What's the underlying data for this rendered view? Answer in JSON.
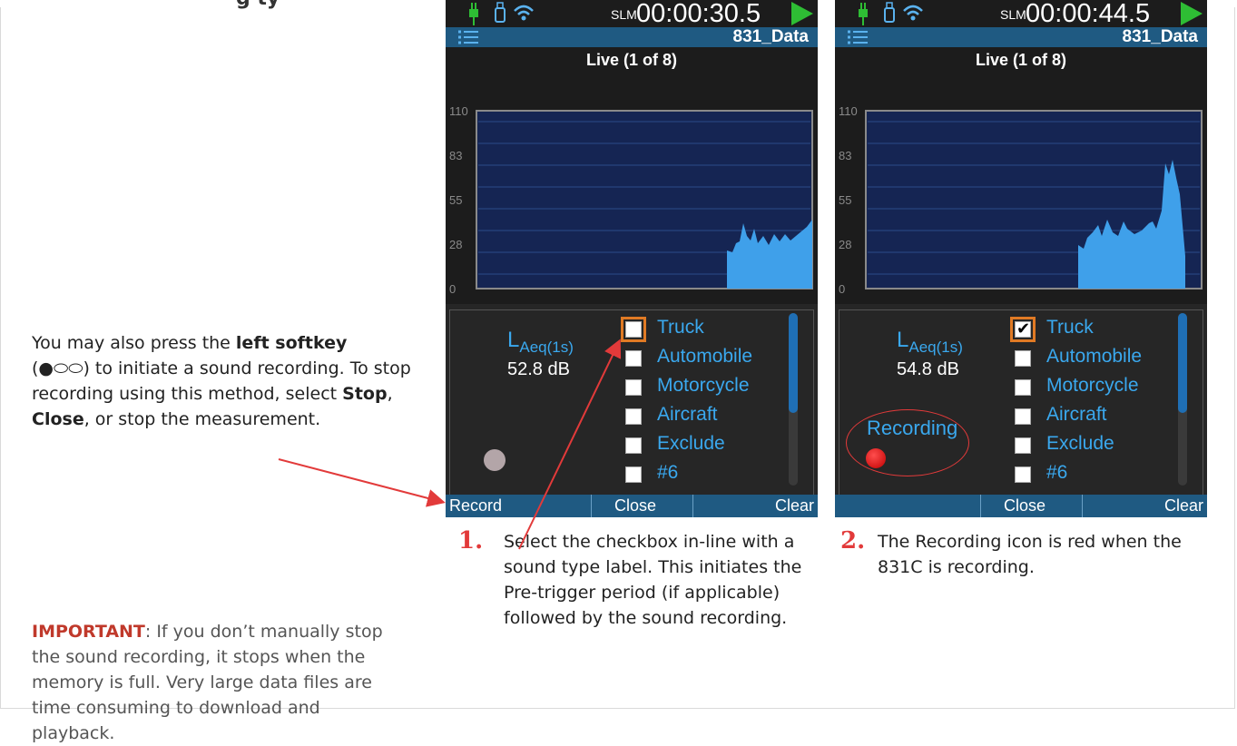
{
  "page": {
    "header_fragment": "g             ty",
    "left_note": {
      "text_1": "You may also press the ",
      "softkey_bold": "left softkey",
      "softkey_symbol": "(●⬭⬭)",
      "text_2": " to initiate a sound recording. To stop recording using this method, select ",
      "stop": "Stop",
      "comma": ", ",
      "close": "Close",
      "text_3": ", or stop the measurement."
    },
    "important": {
      "label": "IMPORTANT",
      "text": ": If you don’t manually stop the sound recording, it stops when the memory is full. Very large data files are time consuming to download and playback."
    },
    "steps": [
      {
        "num": "1.",
        "text": "Select the checkbox in-line with a sound type label. This initiates the Pre-trigger period (if applicable) followed by the sound recording."
      },
      {
        "num": "2.",
        "text": "The Recording icon is red when the 831C is recording."
      }
    ]
  },
  "devices": [
    {
      "slm": "SLM",
      "timer": "00:00:30.5",
      "datafile": "831_Data",
      "live": "Live (1 of 8)",
      "y_ticks": [
        "110",
        "83",
        "55",
        "28",
        "0"
      ],
      "laeq_main": "L",
      "laeq_sub": "Aeq(1s)",
      "db": "52.8 dB",
      "checkboxes": [
        {
          "label": "Truck",
          "checked": false,
          "focused": true
        },
        {
          "label": "Automobile",
          "checked": false
        },
        {
          "label": "Motorcycle",
          "checked": false
        },
        {
          "label": "Aircraft",
          "checked": false
        },
        {
          "label": "Exclude",
          "checked": false
        },
        {
          "label": "#6",
          "checked": false
        }
      ],
      "softkeys": {
        "left": "Record",
        "center": "Close",
        "right": "Clear"
      },
      "recording_label": "",
      "recording_active": false
    },
    {
      "slm": "SLM",
      "timer": "00:00:44.5",
      "datafile": "831_Data",
      "live": "Live (1 of 8)",
      "y_ticks": [
        "110",
        "83",
        "55",
        "28",
        "0"
      ],
      "laeq_main": "L",
      "laeq_sub": "Aeq(1s)",
      "db": "54.8 dB",
      "checkboxes": [
        {
          "label": "Truck",
          "checked": true,
          "focused": true
        },
        {
          "label": "Automobile",
          "checked": false
        },
        {
          "label": "Motorcycle",
          "checked": false
        },
        {
          "label": "Aircraft",
          "checked": false
        },
        {
          "label": "Exclude",
          "checked": false
        },
        {
          "label": "#6",
          "checked": false
        }
      ],
      "softkeys": {
        "left": "",
        "center": "Close",
        "right": "Clear"
      },
      "recording_label": "Recording",
      "recording_active": true
    }
  ],
  "colors": {
    "accent_blue": "#3aa8ee",
    "bar_blue": "#1f5a82",
    "chart_fill": "#1f6fb5",
    "play_green": "#2ebd34",
    "focus_orange": "#e07a24",
    "annotation_red": "#e23a3a"
  },
  "icons": [
    "plug-icon",
    "usb-icon",
    "wifi-icon",
    "play-icon",
    "menu-icon",
    "record-indicator-icon"
  ]
}
